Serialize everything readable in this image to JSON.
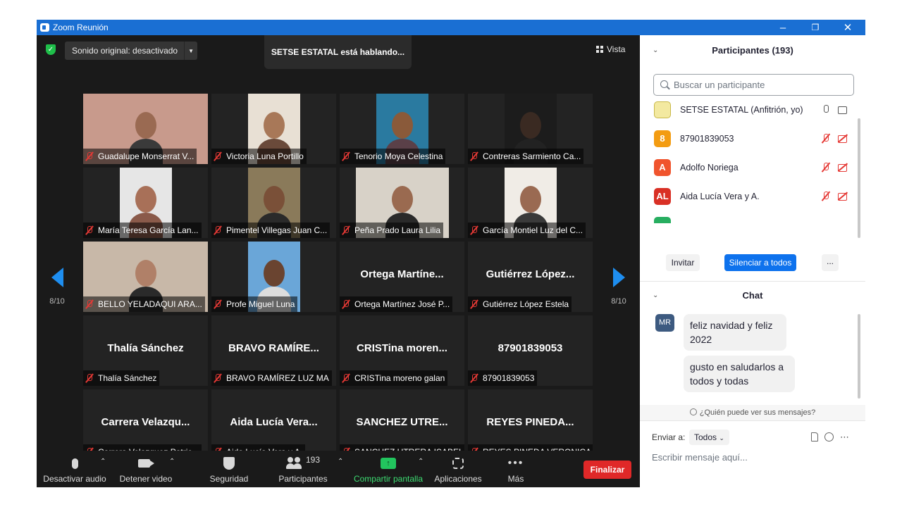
{
  "window": {
    "title": "Zoom Reunión"
  },
  "meeting": {
    "sound_label": "Sonido original: desactivado",
    "speaking": "SETSE ESTATAL está hablando...",
    "view_label": "Vista",
    "page_left": "8/10",
    "page_right": "8/10"
  },
  "tiles": [
    {
      "label": "Guadalupe Monserrat V...",
      "video": true,
      "bg": "#c89a8c",
      "skin": "#9a6a52",
      "shirt": "#3a3a3a",
      "vw": 177
    },
    {
      "label": "Victoria Luna Portillo",
      "video": true,
      "bg": "#e8e0d4",
      "skin": "#a87858",
      "shirt": "#6a4a3a",
      "vw": 74
    },
    {
      "label": "Tenorio Moya Celestina",
      "video": true,
      "bg": "#2a7aa0",
      "skin": "#8a5a3a",
      "shirt": "#5a4048",
      "vw": 74
    },
    {
      "label": "Contreras Sarmiento Ca...",
      "video": true,
      "bg": "#1c1c1c",
      "skin": "#3a2a22",
      "shirt": "#222",
      "vw": 74
    },
    {
      "label": "María Teresa García Lan...",
      "video": true,
      "bg": "#e6e6e6",
      "skin": "#a87058",
      "shirt": "#8a5a4a",
      "vw": 74
    },
    {
      "label": "Pimentel Villegas Juan C...",
      "video": true,
      "bg": "#8a7a5a",
      "skin": "#7a5038",
      "shirt": "#2a2a2a",
      "vw": 74
    },
    {
      "label": "Peña Prado Laura Lilia",
      "video": true,
      "bg": "#d8d2c8",
      "skin": "#9a6a50",
      "shirt": "#2a2a2a",
      "vw": 132
    },
    {
      "label": "García Montiel Luz del C...",
      "video": true,
      "bg": "#f0ece6",
      "skin": "#9a6a52",
      "shirt": "#3a3a3a",
      "vw": 74
    },
    {
      "label": "BELLO YELADAQUI ARA...",
      "video": true,
      "bg": "#c8b8a8",
      "skin": "#b08068",
      "shirt": "#2a2a2a",
      "vw": 177
    },
    {
      "label": "Profe Miguel Luna",
      "video": true,
      "bg": "#6aa6d8",
      "skin": "#6a4430",
      "shirt": "#ddd",
      "vw": 74
    },
    {
      "label": "Ortega Martínez José P...",
      "name": "Ortega  Martíne...",
      "video": false
    },
    {
      "label": "Gutiérrez López Estela",
      "name": "Gutiérrez  López...",
      "video": false
    },
    {
      "label": "Thalía Sánchez",
      "name": "Thalía Sánchez",
      "video": false
    },
    {
      "label": "BRAVO RAMÍREZ LUZ MA",
      "name": "BRAVO RAMÍRE...",
      "video": false
    },
    {
      "label": "CRISTina moreno galan",
      "name": "CRISTina  moren...",
      "video": false
    },
    {
      "label": "87901839053",
      "name": "87901839053",
      "video": false
    },
    {
      "label": "Carrera Velazquez Patric...",
      "name": "Carrera  Velazqu...",
      "video": false
    },
    {
      "label": "Aida Lucía Vera y A.",
      "name": "Aida Lucía Vera...",
      "video": false
    },
    {
      "label": "SANCHEZ UTRERA ISABEL",
      "name": "SANCHEZ  UTRE...",
      "video": false
    },
    {
      "label": "REYES PINEDA VERONICA",
      "name": "REYES  PINEDA...",
      "video": false
    }
  ],
  "toolbar": {
    "mute": "Desactivar audio",
    "video": "Detener video",
    "security": "Seguridad",
    "participants": "Participantes",
    "participants_count": "193",
    "share": "Compartir pantalla",
    "apps": "Aplicaciones",
    "more": "Más",
    "end": "Finalizar"
  },
  "participants_panel": {
    "title": "Participantes (193)",
    "search_placeholder": "Buscar un participante",
    "list": [
      {
        "avatar": "",
        "color": "#f3e9a0",
        "name": "SETSE ESTATAL (Anfitrión, yo)",
        "host": true
      },
      {
        "avatar": "8",
        "color": "#f39c12",
        "name": "87901839053",
        "host": false
      },
      {
        "avatar": "A",
        "color": "#f0542d",
        "name": "Adolfo Noriega",
        "host": false
      },
      {
        "avatar": "AL",
        "color": "#d93025",
        "name": "Aida Lucía Vera y A.",
        "host": false
      }
    ],
    "invite": "Invitar",
    "mute_all": "Silenciar a todos",
    "more": "..."
  },
  "chat": {
    "title": "Chat",
    "sender_avatar": "MR",
    "messages": [
      "feliz navidad y feliz 2022",
      "gusto en saludarlos a todos y todas"
    ],
    "who_can_see": "¿Quién puede ver sus mensajes?",
    "send_to_label": "Enviar a:",
    "send_to_value": "Todos",
    "input_placeholder": "Escribir mensaje aquí..."
  }
}
